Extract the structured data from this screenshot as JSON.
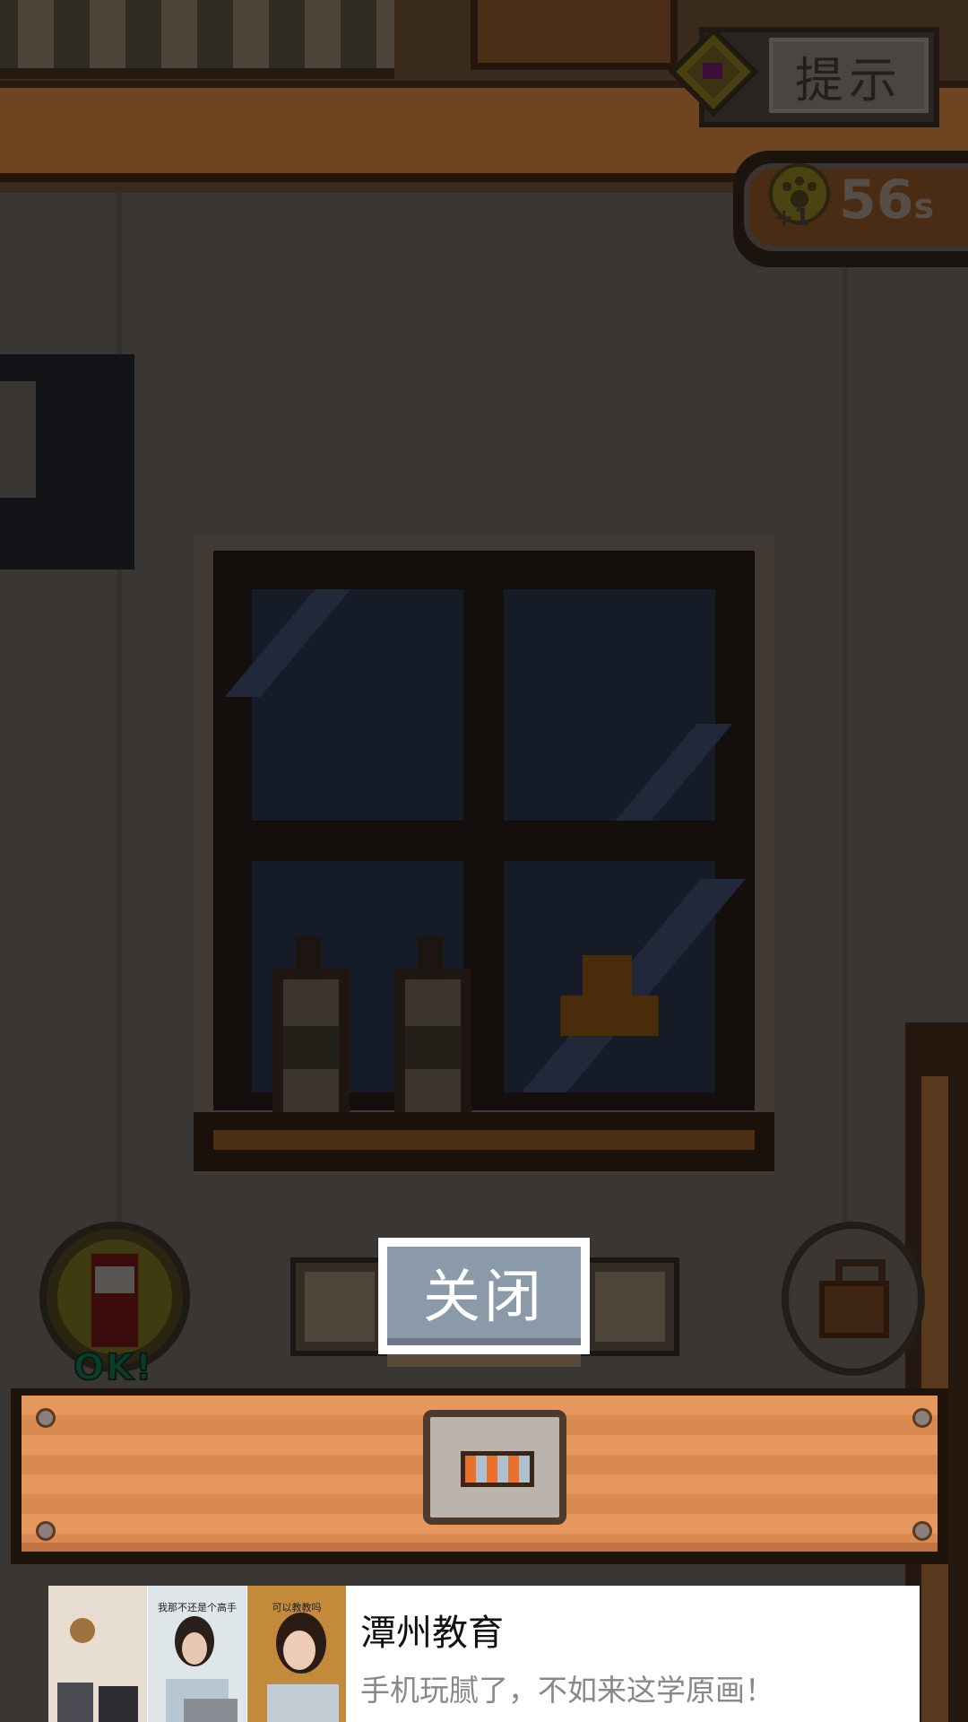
{
  "hud": {
    "hint_label": "提示",
    "timer_value": "56",
    "timer_unit": "s",
    "hint_bonus": "+1"
  },
  "inventory": {
    "ok_badge": "OK!",
    "close_label": "关闭"
  },
  "ad": {
    "image_captions": [
      "",
      "我那不还是个高手",
      "可以教教吗"
    ],
    "title": "潭州教育",
    "description": "手机玩腻了，不如来这学原画！"
  },
  "colors": {
    "close_button": "#8a9aa9",
    "panel_wood": "#e6975d",
    "dim_overlay": "#3a3633"
  },
  "icons": {
    "hint": "gem-icon",
    "timer": "paw-icon",
    "bag": "bag-icon",
    "item_selected": "striped-card-icon",
    "item_ok": "bottle-icon"
  }
}
